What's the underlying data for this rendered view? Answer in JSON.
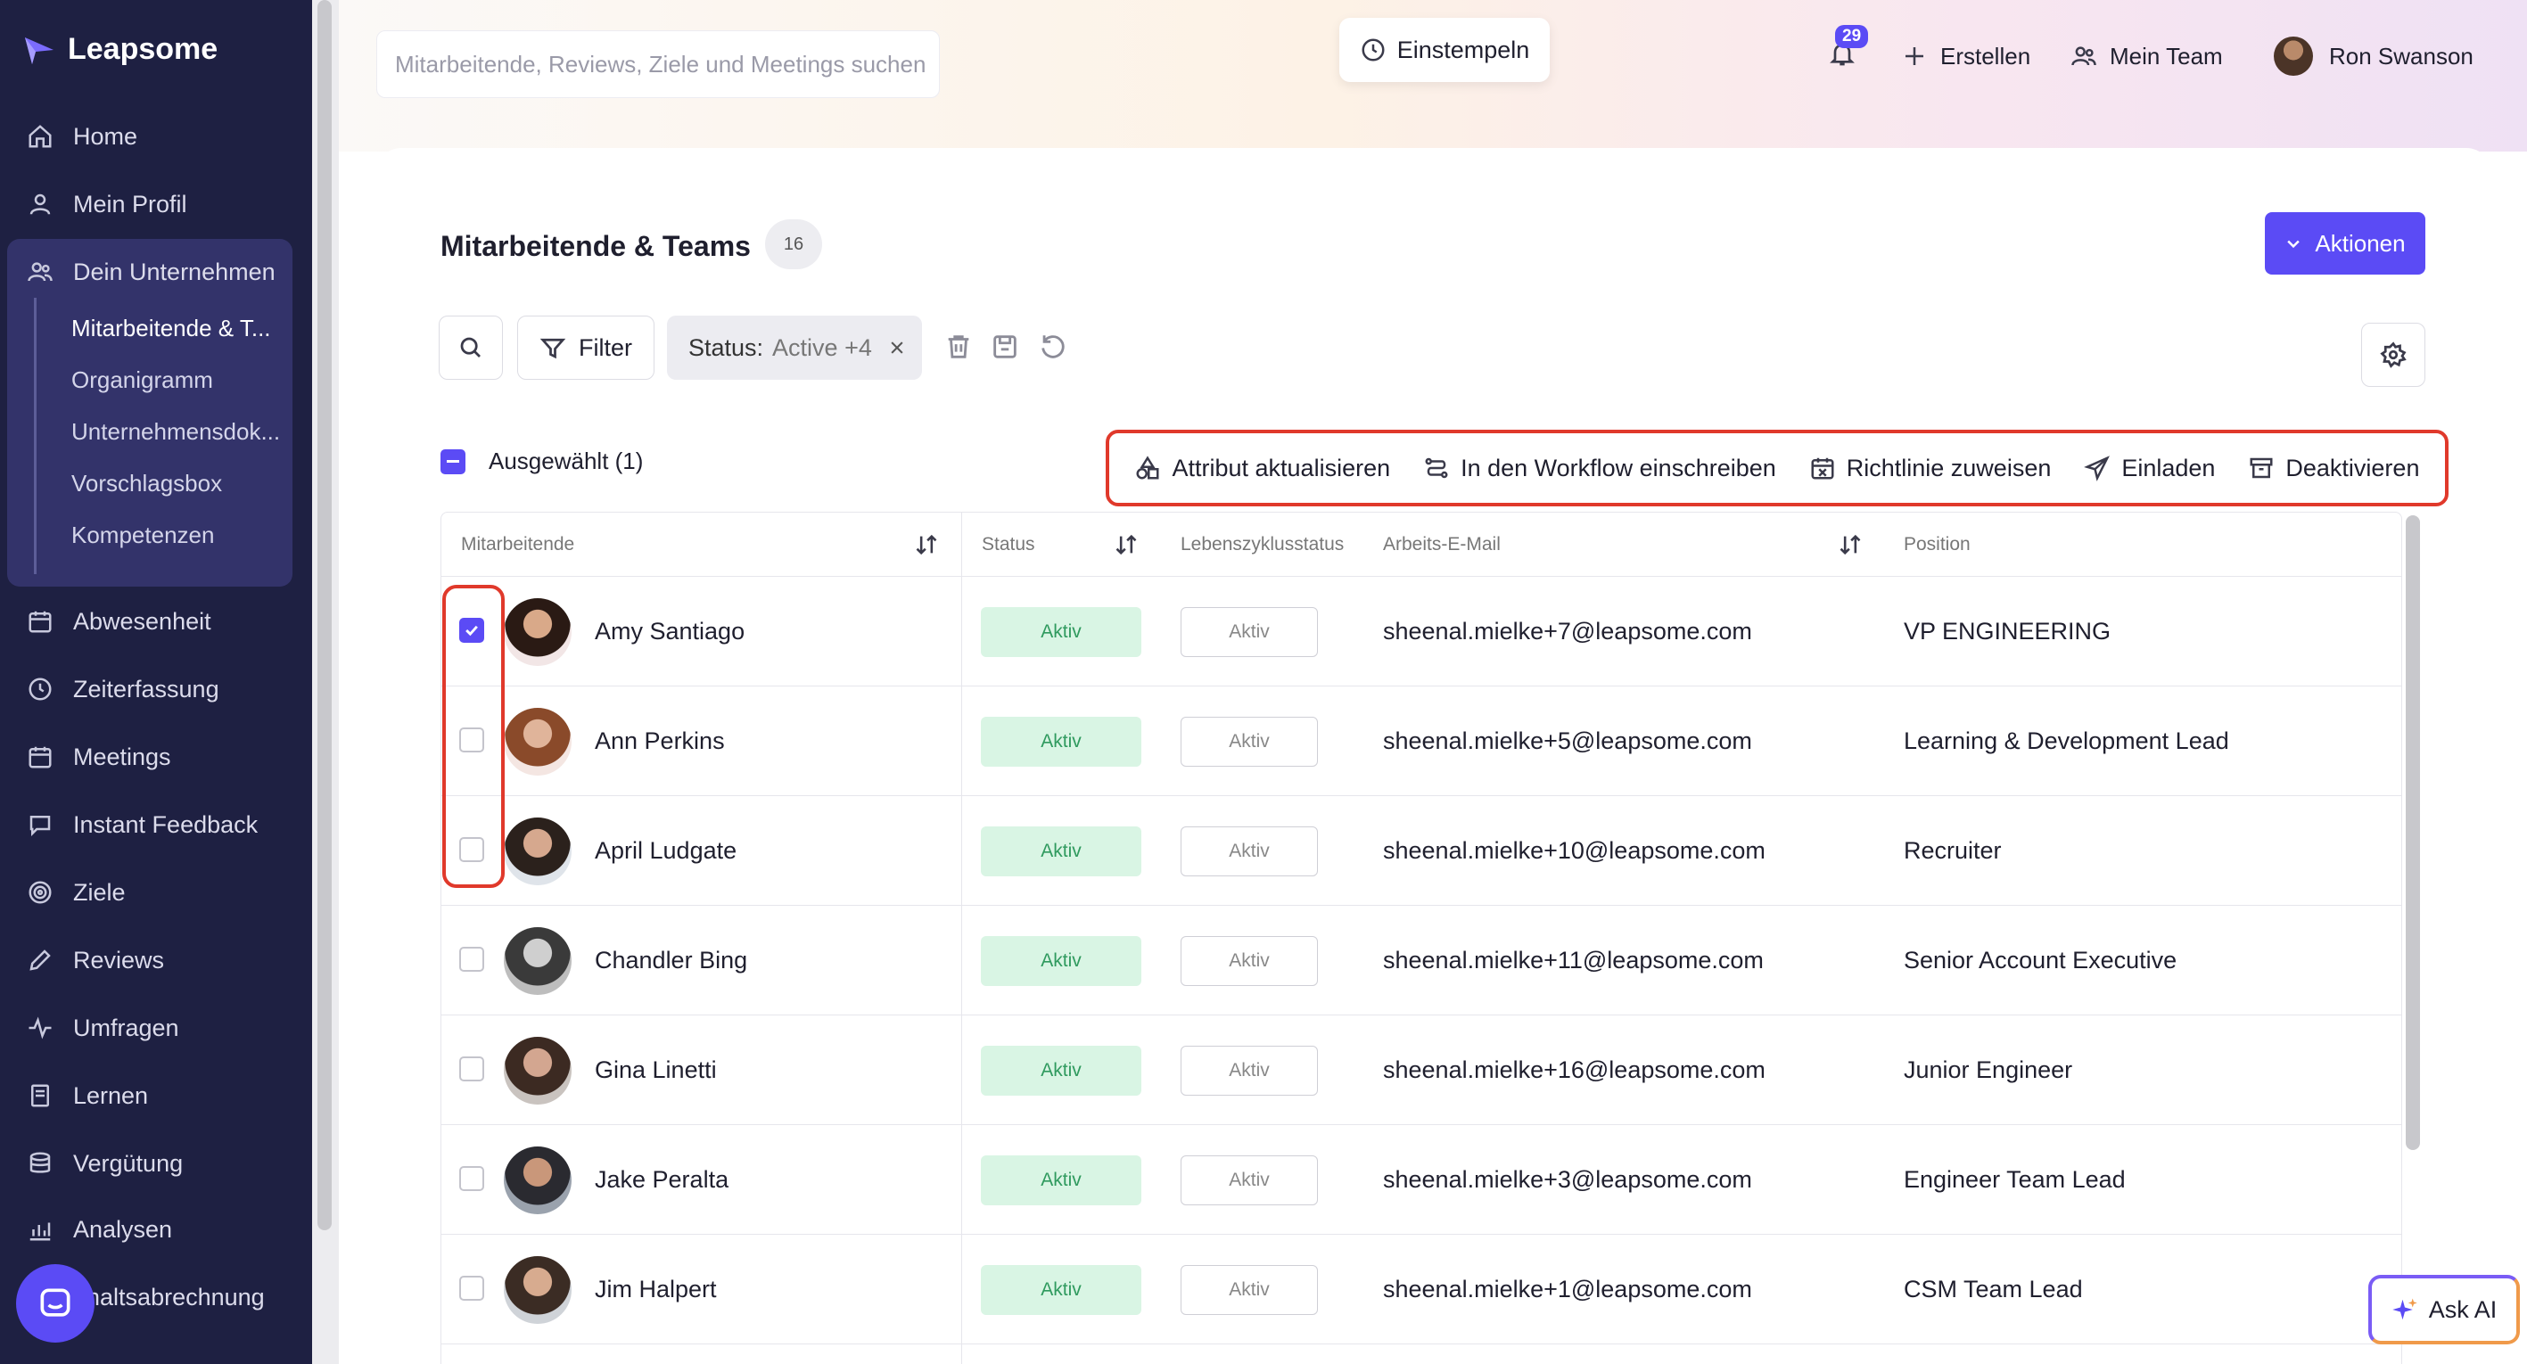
{
  "app": {
    "brand": "Leapsome"
  },
  "sidebar": {
    "items": [
      {
        "label": "Home",
        "icon": "home-icon"
      },
      {
        "label": "Mein Profil",
        "icon": "user-icon"
      },
      {
        "label": "Dein Unternehmen",
        "icon": "users-icon"
      },
      {
        "label": "Abwesenheit",
        "icon": "calendar-icon"
      },
      {
        "label": "Zeiterfassung",
        "icon": "clock-icon"
      },
      {
        "label": "Meetings",
        "icon": "calendar-icon"
      },
      {
        "label": "Instant Feedback",
        "icon": "chat-icon"
      },
      {
        "label": "Ziele",
        "icon": "target-icon"
      },
      {
        "label": "Reviews",
        "icon": "pen-icon"
      },
      {
        "label": "Umfragen",
        "icon": "pulse-icon"
      },
      {
        "label": "Lernen",
        "icon": "book-icon"
      },
      {
        "label": "Vergütung",
        "icon": "coins-icon"
      },
      {
        "label": "Analysen",
        "icon": "chart-icon"
      },
      {
        "label": "ehaltsabrechnung",
        "icon": "chat-bubble-icon"
      }
    ],
    "sub_items": [
      {
        "label": "Mitarbeitende & T..."
      },
      {
        "label": "Organigramm"
      },
      {
        "label": "Unternehmensdok..."
      },
      {
        "label": "Vorschlagsbox"
      },
      {
        "label": "Kompetenzen"
      }
    ]
  },
  "topbar": {
    "search_placeholder": "Mitarbeitende, Reviews, Ziele und Meetings suchen",
    "clockin_label": "Einstempeln",
    "notification_count": "29",
    "create_label": "Erstellen",
    "team_label": "Mein Team",
    "user_name": "Ron Swanson"
  },
  "page": {
    "title": "Mitarbeitende & Teams",
    "count": "16",
    "actions_label": "Aktionen"
  },
  "filters": {
    "filter_label": "Filter",
    "status_key": "Status:",
    "status_value": "Active +4"
  },
  "selection": {
    "label": "Ausgewählt (1)"
  },
  "bulk_actions": [
    {
      "label": "Attribut aktualisieren",
      "icon": "shapes-icon"
    },
    {
      "label": "In den Workflow einschreiben",
      "icon": "workflow-icon"
    },
    {
      "label": "Richtlinie zuweisen",
      "icon": "calendar-x-icon"
    },
    {
      "label": "Einladen",
      "icon": "send-icon"
    },
    {
      "label": "Deaktivieren",
      "icon": "archive-icon"
    }
  ],
  "table": {
    "columns": [
      "Mitarbeitende",
      "Status",
      "Lebenszyklusstatus",
      "Arbeits-E-Mail",
      "Position"
    ],
    "rows": [
      {
        "name": "Amy Santiago",
        "status": "Aktiv",
        "lifecycle": "Aktiv",
        "email": "sheenal.mielke+7@leapsome.com",
        "position": "VP ENGINEERING",
        "checked": true
      },
      {
        "name": "Ann Perkins",
        "status": "Aktiv",
        "lifecycle": "Aktiv",
        "email": "sheenal.mielke+5@leapsome.com",
        "position": "Learning & Development Lead",
        "checked": false
      },
      {
        "name": "April Ludgate",
        "status": "Aktiv",
        "lifecycle": "Aktiv",
        "email": "sheenal.mielke+10@leapsome.com",
        "position": "Recruiter",
        "checked": false
      },
      {
        "name": "Chandler Bing",
        "status": "Aktiv",
        "lifecycle": "Aktiv",
        "email": "sheenal.mielke+11@leapsome.com",
        "position": "Senior Account Executive",
        "checked": false
      },
      {
        "name": "Gina Linetti",
        "status": "Aktiv",
        "lifecycle": "Aktiv",
        "email": "sheenal.mielke+16@leapsome.com",
        "position": "Junior Engineer",
        "checked": false
      },
      {
        "name": "Jake Peralta",
        "status": "Aktiv",
        "lifecycle": "Aktiv",
        "email": "sheenal.mielke+3@leapsome.com",
        "position": "Engineer Team Lead",
        "checked": false
      },
      {
        "name": "Jim Halpert",
        "status": "Aktiv",
        "lifecycle": "Aktiv",
        "email": "sheenal.mielke+1@leapsome.com",
        "position": "CSM Team Lead",
        "checked": false
      }
    ]
  },
  "ask_ai": {
    "label": "Ask AI"
  },
  "colors": {
    "accent": "#5b4bf5",
    "sidebar": "#1e2042",
    "highlight": "#e0392b",
    "active_green": "#d9f5e4"
  }
}
